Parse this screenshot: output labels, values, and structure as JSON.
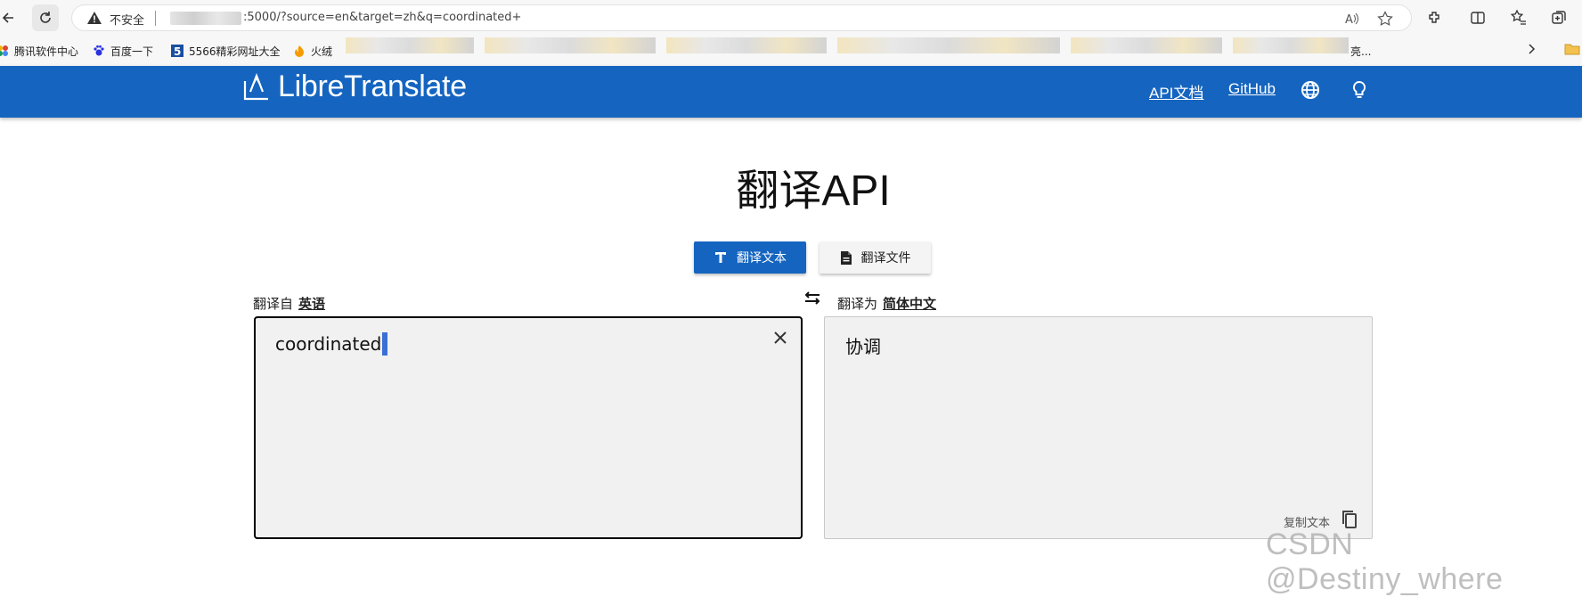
{
  "browser": {
    "not_secure": "不安全",
    "url": ":5000/?source=en&target=zh&q=coordinated+",
    "bookmarks": [
      {
        "label": "腾讯软件中心",
        "icon": "flower-icon"
      },
      {
        "label": "百度一下",
        "icon": "paw-icon"
      },
      {
        "label": "5566精彩网址大全",
        "icon": "badge-5-icon"
      },
      {
        "label": "火绒",
        "icon": "flame-icon"
      }
    ],
    "bookmark_overflow": "亮..."
  },
  "header": {
    "brand": "LibreTranslate",
    "links": [
      "API文档",
      "GitHub"
    ],
    "icons": [
      "globe-icon",
      "lightbulb-icon"
    ],
    "color": "#1565c0"
  },
  "main": {
    "title": "翻译API",
    "tabs": [
      {
        "label": "翻译文本",
        "icon": "text-icon",
        "active": true
      },
      {
        "label": "翻译文件",
        "icon": "file-icon",
        "active": false
      }
    ],
    "source": {
      "prefix": "翻译自",
      "language": "英语",
      "text": "coordinated"
    },
    "target": {
      "prefix": "翻译为",
      "language": "简体中文",
      "text": "协调"
    },
    "copy_label": "复制文本"
  },
  "watermark": "CSDN @Destiny_where"
}
